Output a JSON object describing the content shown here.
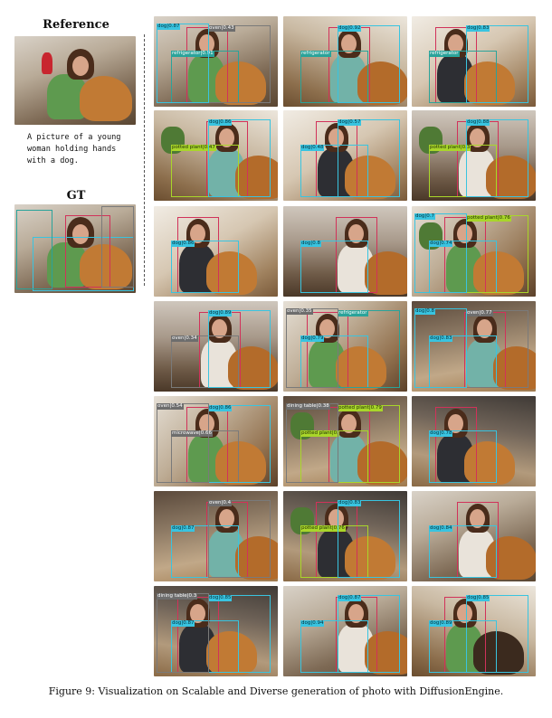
{
  "reference": {
    "title": "Reference",
    "caption_lines": [
      "A picture of a young",
      "woman holding hands",
      "with a dog."
    ]
  },
  "gt": {
    "title": "GT"
  },
  "figure_caption": "Figure 9: Visualization on Scalable and Diverse generation of photo with DiffusionEngine.",
  "colors": {
    "dog_box": "#39c4e0",
    "person_box": "#d1325a",
    "refrigerator_box": "#2aa39a",
    "plant_box": "#a9d62a"
  },
  "grid": [
    {
      "row": 1,
      "col": 1,
      "labels": [
        "refrigerator|0.91",
        "oven|0.43",
        "dog|0.87"
      ]
    },
    {
      "row": 1,
      "col": 2,
      "labels": [
        "refrigerator",
        "dog|0.92"
      ]
    },
    {
      "row": 1,
      "col": 3,
      "labels": [
        "refrigerator",
        "dog|0.83"
      ]
    },
    {
      "row": 2,
      "col": 1,
      "labels": [
        "potted plant|0.47",
        "dog|0.86"
      ]
    },
    {
      "row": 2,
      "col": 2,
      "labels": [
        "dog|0.48",
        "dog|0.57"
      ]
    },
    {
      "row": 2,
      "col": 3,
      "labels": [
        "potted plant|0.3",
        "dog|0.88"
      ]
    },
    {
      "row": 3,
      "col": 1,
      "labels": [
        "dog|0.86"
      ]
    },
    {
      "row": 3,
      "col": 2,
      "labels": [
        "dog|0.8"
      ]
    },
    {
      "row": 3,
      "col": 3,
      "labels": [
        "dog|0.74",
        "potted plant|0.76",
        "dog|0.7"
      ]
    },
    {
      "row": 4,
      "col": 1,
      "labels": [
        "oven|0.34",
        "dog|0.89"
      ]
    },
    {
      "row": 4,
      "col": 2,
      "labels": [
        "dog|0.79",
        "refrigerator",
        "oven|0.35"
      ]
    },
    {
      "row": 4,
      "col": 3,
      "labels": [
        "dog|0.83",
        "oven|0.77",
        "dog|0.8"
      ]
    },
    {
      "row": 5,
      "col": 1,
      "labels": [
        "microwave|0.66",
        "dog|0.86",
        "oven|0.54"
      ]
    },
    {
      "row": 5,
      "col": 2,
      "labels": [
        "potted plant|0.",
        "potted plant|0.79",
        "dining table|0.38"
      ]
    },
    {
      "row": 5,
      "col": 3,
      "labels": [
        "dog|0.78"
      ]
    },
    {
      "row": 6,
      "col": 1,
      "labels": [
        "dog|0.87",
        "oven|0.4"
      ]
    },
    {
      "row": 6,
      "col": 2,
      "labels": [
        "potted plant|0.76",
        "dog|0.83"
      ]
    },
    {
      "row": 6,
      "col": 3,
      "labels": [
        "dog|0.84"
      ]
    },
    {
      "row": 7,
      "col": 1,
      "labels": [
        "dog|0.87",
        "dog|0.85",
        "dining table|0.3"
      ]
    },
    {
      "row": 7,
      "col": 2,
      "labels": [
        "dog|0.94",
        "dog|0.87"
      ]
    },
    {
      "row": 7,
      "col": 3,
      "labels": [
        "dog|0.89",
        "dog|0.85"
      ]
    }
  ]
}
